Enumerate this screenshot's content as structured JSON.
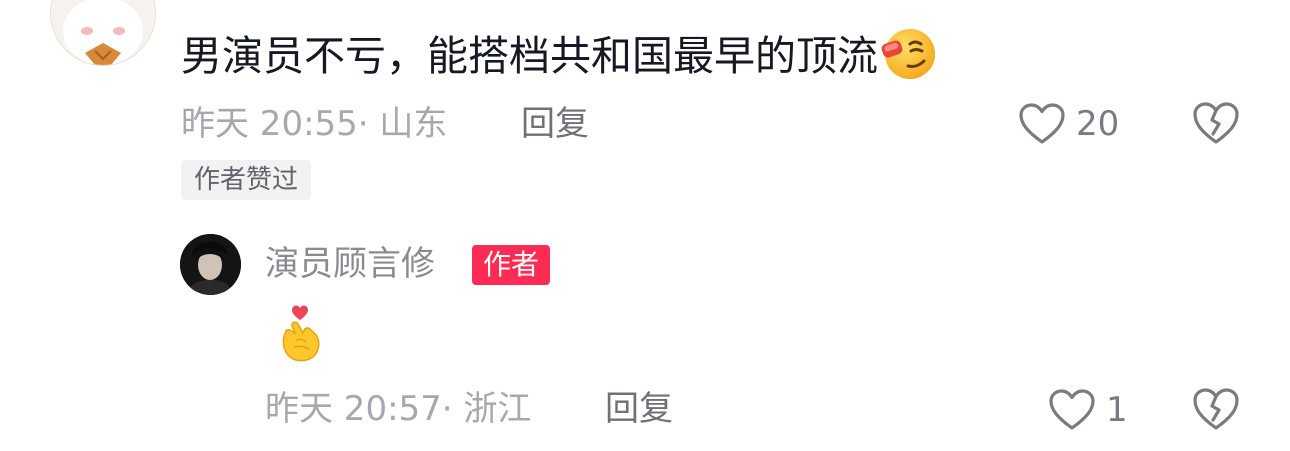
{
  "comment": {
    "text": "男演员不亏，能搭档共和国最早的顶流",
    "text_emoji": "smirk-emoji",
    "time": "昨天 20:55· 山东",
    "reply_label": "回复",
    "like_count": "20",
    "liked_by_author_badge": "作者赞过"
  },
  "reply": {
    "username": "演员顾言修",
    "author_badge": "作者",
    "content_emoji": "finger-heart-emoji",
    "time": "昨天 20:57· 浙江",
    "reply_label": "回复",
    "like_count": "1"
  },
  "colors": {
    "primary_text": "#161823",
    "secondary_text": "#a7a8ad",
    "author_badge_bg": "#fe2c55",
    "liked_badge_bg": "#f2f2f3"
  }
}
